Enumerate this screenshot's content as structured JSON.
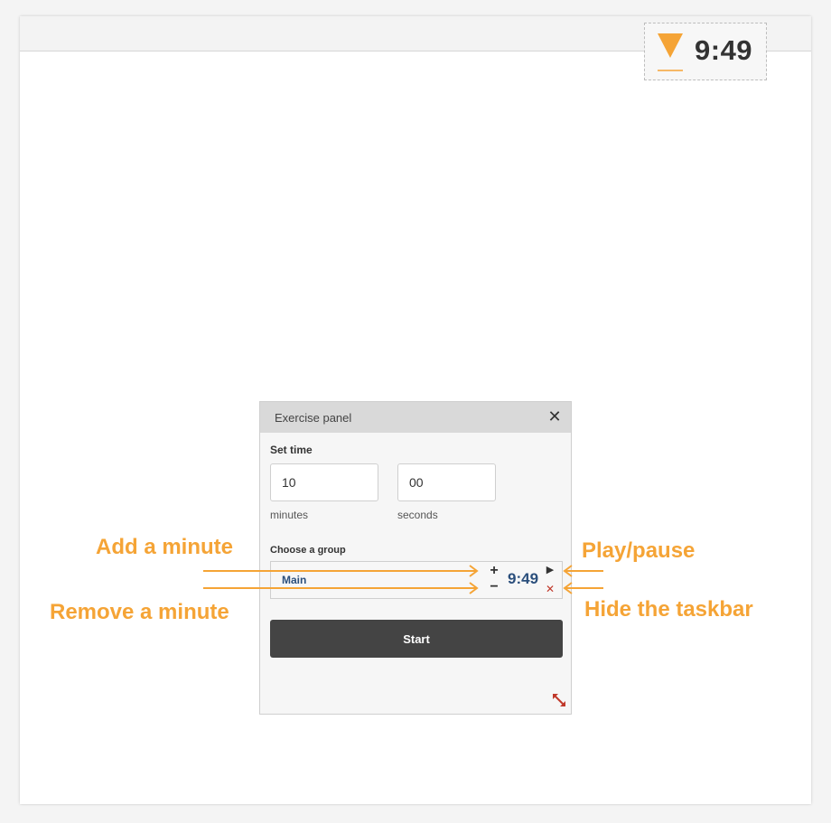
{
  "timer_widget": {
    "time": "9:49"
  },
  "panel": {
    "title": "Exercise panel",
    "set_time_label": "Set time",
    "minutes_value": "10",
    "seconds_value": "00",
    "minutes_label": "minutes",
    "seconds_label": "seconds",
    "group_label": "Choose a group",
    "group_name": "Main",
    "mini_time": "9:49",
    "start_label": "Start"
  },
  "annotations": {
    "add_minute": "Add a minute",
    "remove_minute": "Remove a minute",
    "play_pause": "Play/pause",
    "hide_taskbar": "Hide the taskbar"
  },
  "icons": {
    "hourglass": "hourglass-icon",
    "close": "close-icon",
    "plus": "plus-icon",
    "minus": "minus-icon",
    "play": "play-icon",
    "hide": "close-x-icon",
    "resize": "resize-icon"
  },
  "colors": {
    "accent_orange": "#f5a436",
    "dark_button": "#444444",
    "mini_time_blue": "#2b4f7c",
    "hide_red": "#c0392b"
  }
}
